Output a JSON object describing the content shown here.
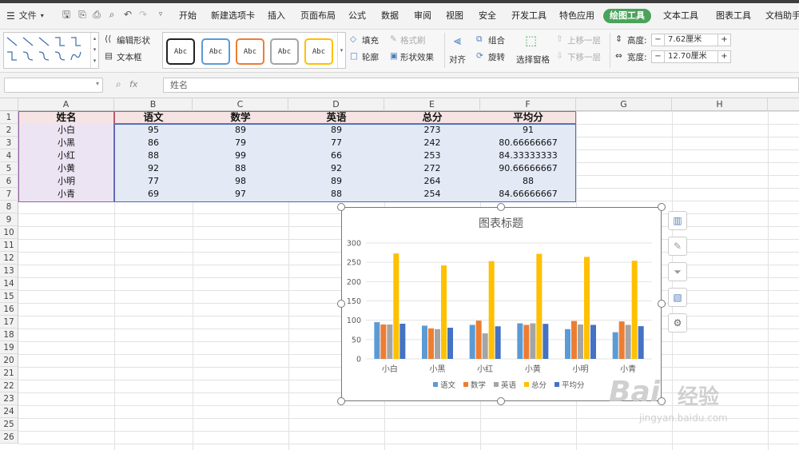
{
  "menu": {
    "file_label": "文件"
  },
  "tabs": [
    {
      "label": "开始"
    },
    {
      "label": "新建选项卡"
    },
    {
      "label": "插入"
    },
    {
      "label": "页面布局"
    },
    {
      "label": "公式"
    },
    {
      "label": "数据"
    },
    {
      "label": "审阅"
    },
    {
      "label": "视图"
    },
    {
      "label": "安全"
    },
    {
      "label": "开发工具"
    },
    {
      "label": "特色应用"
    },
    {
      "label": "绘图工具"
    },
    {
      "label": "文本工具"
    },
    {
      "label": "图表工具"
    },
    {
      "label": "文档助手"
    }
  ],
  "ribbon": {
    "edit_shape": "编辑形状",
    "text_box": "文本框",
    "style_labels": [
      "Abc",
      "Abc",
      "Abc",
      "Abc",
      "Abc"
    ],
    "fill": "填充",
    "format_brush": "格式刷",
    "outline": "轮廓",
    "shape_effect": "形状效果",
    "align": "对齐",
    "group": "组合",
    "rotate": "旋转",
    "selection_pane": "选择窗格",
    "bring_forward": "上移一层",
    "send_backward": "下移一层",
    "height_label": "高度:",
    "height_value": "7.62厘米",
    "width_label": "宽度:",
    "width_value": "12.70厘米",
    "minus": "−",
    "plus": "+"
  },
  "formula_bar": {
    "fx": "fx",
    "value": "姓名"
  },
  "columns": [
    "A",
    "B",
    "C",
    "D",
    "E",
    "F",
    "G",
    "H"
  ],
  "rows": [
    "1",
    "2",
    "3",
    "4",
    "5",
    "6",
    "7",
    "8",
    "9",
    "10",
    "11",
    "12",
    "13",
    "14",
    "15",
    "16",
    "17",
    "18",
    "19",
    "20",
    "21",
    "22",
    "23",
    "24",
    "25",
    "26"
  ],
  "table": {
    "headers": [
      "姓名",
      "语文",
      "数学",
      "英语",
      "总分",
      "平均分"
    ],
    "rows": [
      [
        "小白",
        "95",
        "89",
        "89",
        "273",
        "91"
      ],
      [
        "小黑",
        "86",
        "79",
        "77",
        "242",
        "80.66666667"
      ],
      [
        "小红",
        "88",
        "99",
        "66",
        "253",
        "84.33333333"
      ],
      [
        "小黄",
        "92",
        "88",
        "92",
        "272",
        "90.66666667"
      ],
      [
        "小明",
        "77",
        "98",
        "89",
        "264",
        "88"
      ],
      [
        "小青",
        "69",
        "97",
        "88",
        "254",
        "84.66666667"
      ]
    ]
  },
  "colors": {
    "accent": "#4aa35b",
    "chinese": "#5b9bd5",
    "math": "#ed7d31",
    "english": "#a5a5a5",
    "total": "#ffc000",
    "average": "#4472c4"
  },
  "chart_data": {
    "type": "bar",
    "title": "图表标题",
    "categories": [
      "小白",
      "小黑",
      "小红",
      "小黄",
      "小明",
      "小青"
    ],
    "series": [
      {
        "name": "语文",
        "values": [
          95,
          86,
          88,
          92,
          77,
          69
        ]
      },
      {
        "name": "数学",
        "values": [
          89,
          79,
          99,
          88,
          98,
          97
        ]
      },
      {
        "name": "英语",
        "values": [
          89,
          77,
          66,
          92,
          89,
          88
        ]
      },
      {
        "name": "总分",
        "values": [
          273,
          242,
          253,
          272,
          264,
          254
        ]
      },
      {
        "name": "平均分",
        "values": [
          91,
          80.67,
          84.33,
          90.67,
          88,
          84.67
        ]
      }
    ],
    "y_ticks": [
      "0",
      "50",
      "100",
      "150",
      "200",
      "250",
      "300"
    ],
    "ylim": [
      0,
      300
    ],
    "grid": true,
    "legend": "bottom"
  },
  "watermark": {
    "main": "Bai",
    "cn": "经验",
    "url": "jingyan.baidu.com"
  }
}
